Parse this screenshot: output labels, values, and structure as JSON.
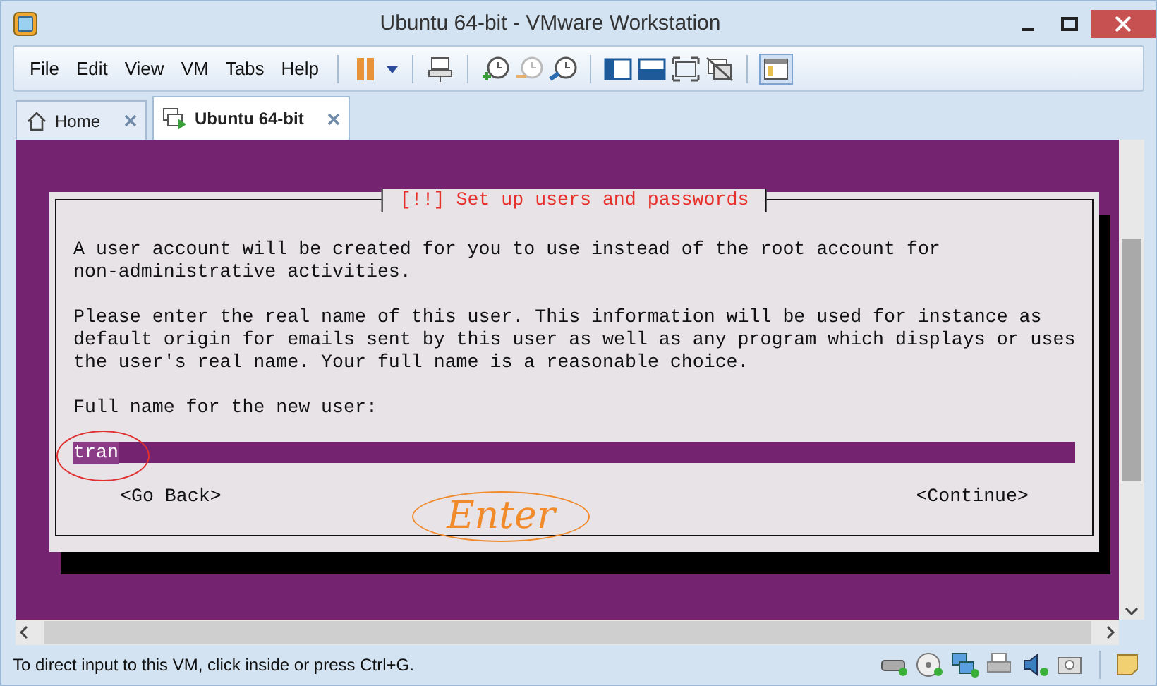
{
  "window": {
    "title": "Ubuntu 64-bit - VMware Workstation"
  },
  "menu": [
    "File",
    "Edit",
    "View",
    "VM",
    "Tabs",
    "Help"
  ],
  "tabs": [
    {
      "label": "Home",
      "selected": false
    },
    {
      "label": "Ubuntu 64-bit",
      "selected": true
    }
  ],
  "dialog": {
    "title": "[!!] Set up users and passwords",
    "paragraphs": [
      "A user account will be created for you to use instead of the root account for\nnon-administrative activities.",
      "Please enter the real name of this user. This information will be used for instance as\ndefault origin for emails sent by this user as well as any program which displays or uses\nthe user's real name. Your full name is a reasonable choice."
    ],
    "prompt": "Full name for the new user:",
    "value": "tran",
    "buttons": [
      "<Go Back>",
      "<Continue>"
    ]
  },
  "annotation": {
    "text": "Enter"
  },
  "status_bar": {
    "text": "To direct input to this VM, click inside or press Ctrl+G."
  }
}
